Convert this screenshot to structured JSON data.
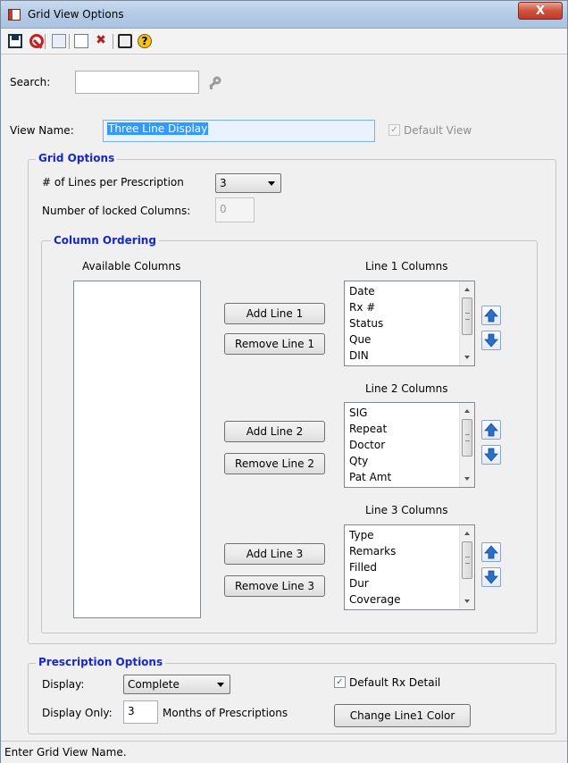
{
  "window": {
    "title": "Grid View Options",
    "close_glyph": "X"
  },
  "toolbar": {
    "icons": [
      "save-icon",
      "cancel-icon",
      "edit-icon",
      "copy-icon",
      "delete-icon",
      "view-icon",
      "help-icon"
    ],
    "help_glyph": "?"
  },
  "search": {
    "label": "Search:",
    "value": ""
  },
  "view": {
    "name_label": "View Name:",
    "name_value": "Three Line Display",
    "default_label": "Default View",
    "default_checked": true
  },
  "grid_options": {
    "title": "Grid Options",
    "lines_label": "# of Lines per Prescription",
    "lines_value": "3",
    "locked_label": "Number of locked Columns:",
    "locked_value": "0"
  },
  "column_ordering": {
    "title": "Column Ordering",
    "available_header": "Available Columns",
    "available_items": [],
    "lines": [
      {
        "header": "Line 1 Columns",
        "add_label": "Add Line 1",
        "remove_label": "Remove Line 1",
        "items": [
          "Date",
          "Rx #",
          "Status",
          "Que",
          "DIN"
        ]
      },
      {
        "header": "Line 2 Columns",
        "add_label": "Add Line 2",
        "remove_label": "Remove Line 2",
        "items": [
          "SIG",
          "Repeat",
          "Doctor",
          "Qty",
          "Pat Amt"
        ]
      },
      {
        "header": "Line 3 Columns",
        "add_label": "Add Line 3",
        "remove_label": "Remove Line 3",
        "items": [
          "Type",
          "Remarks",
          "Filled",
          "Dur",
          "Coverage"
        ]
      }
    ]
  },
  "prescription_options": {
    "title": "Prescription Options",
    "display_label": "Display:",
    "display_value": "Complete",
    "default_detail_label": "Default Rx Detail",
    "default_detail_checked": true,
    "display_only_label": "Display Only:",
    "display_only_value": "3",
    "months_label": "Months of Prescriptions",
    "color_button": "Change Line1 Color"
  },
  "status": {
    "text": "Enter Grid View Name."
  },
  "colors": {
    "group_title": "#1727c9",
    "selection": "#3399ff",
    "arrow_blue": "#2a6fc9"
  }
}
